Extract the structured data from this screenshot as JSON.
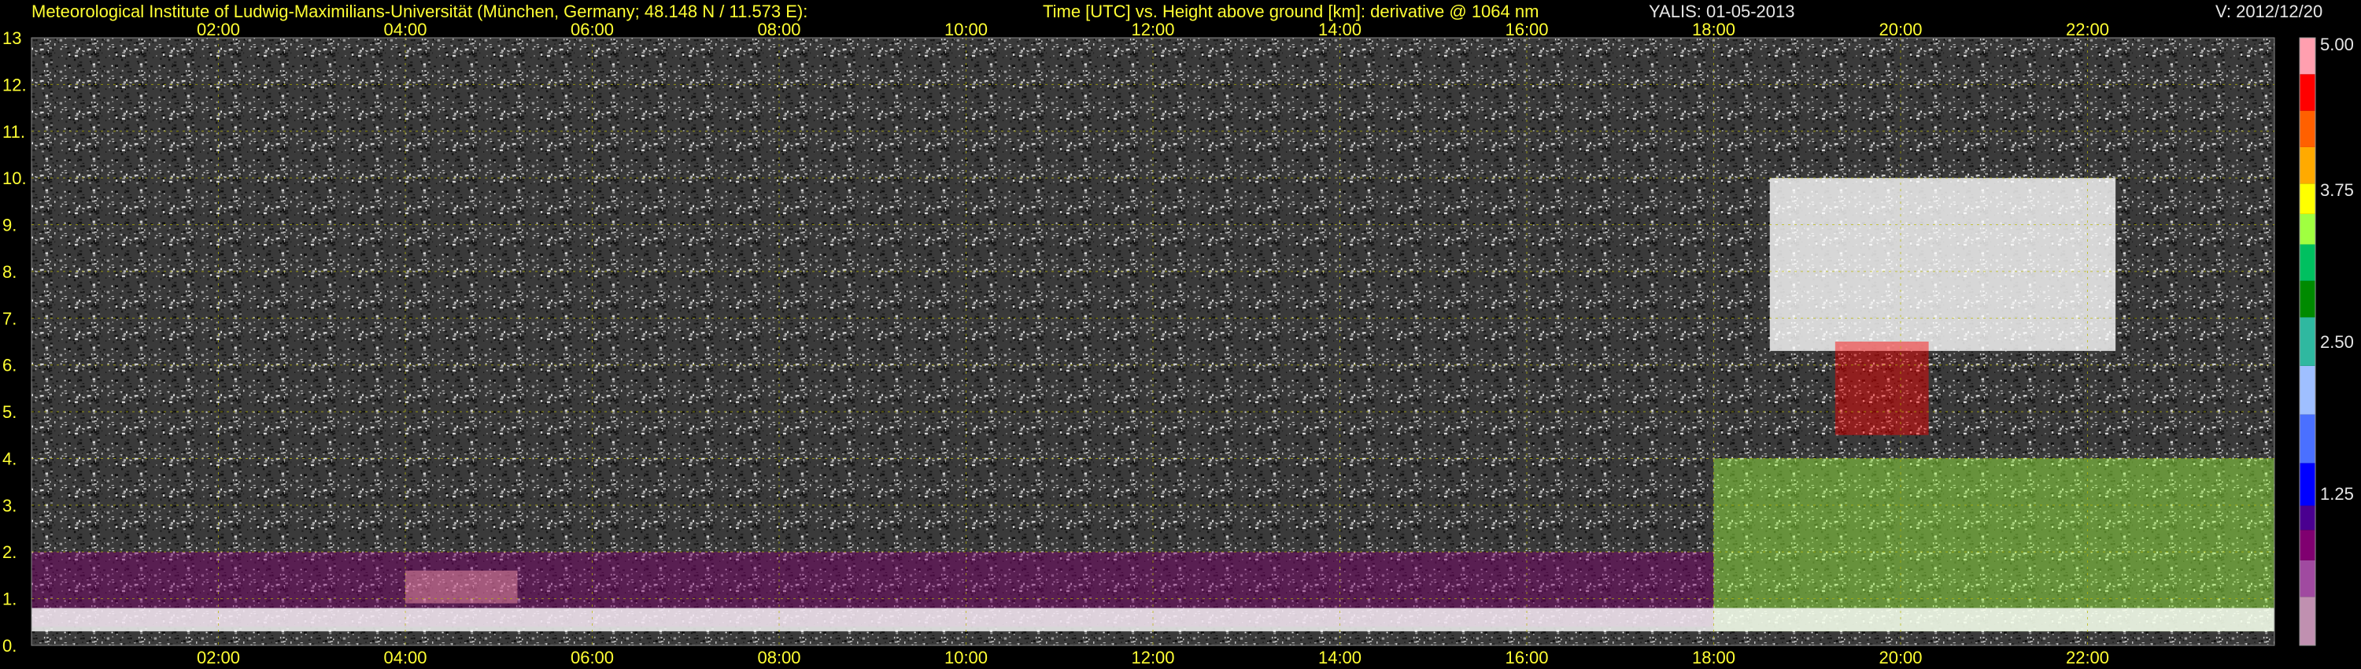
{
  "header": {
    "left": "Meteorological Institute of Ludwig-Maximilians-Universität (München, Germany; 48.148 N / 11.573 E):",
    "middle": "Time [UTC] vs. Height above ground [km]: derivative @ 1064 nm",
    "date": "YALIS: 01-05-2013",
    "version": "V: 2012/12/20"
  },
  "chart_data": {
    "type": "heatmap",
    "xlabel": "Time [UTC]",
    "ylabel": "Height above ground [km]",
    "x_unit": "hours UTC",
    "xlim": [
      0,
      24
    ],
    "ylim": [
      0,
      13
    ],
    "x_ticks": [
      {
        "value": 2,
        "label": "02:00"
      },
      {
        "value": 4,
        "label": "04:00"
      },
      {
        "value": 6,
        "label": "06:00"
      },
      {
        "value": 8,
        "label": "08:00"
      },
      {
        "value": 10,
        "label": "10:00"
      },
      {
        "value": 12,
        "label": "12:00"
      },
      {
        "value": 14,
        "label": "14:00"
      },
      {
        "value": 16,
        "label": "16:00"
      },
      {
        "value": 18,
        "label": "18:00"
      },
      {
        "value": 20,
        "label": "20:00"
      },
      {
        "value": 22,
        "label": "22:00"
      }
    ],
    "y_ticks": [
      0,
      1,
      2,
      3,
      4,
      5,
      6,
      7,
      8,
      9,
      10,
      11,
      12,
      13
    ],
    "y_tick_labels": [
      "0.",
      "1.",
      "2.",
      "3.",
      "4.",
      "5.",
      "6.",
      "7.",
      "8.",
      "9.",
      "10.",
      "11.",
      "12.",
      "13"
    ],
    "grid": true,
    "colorbar": {
      "range": [
        0,
        5.0
      ],
      "tick_values": [
        1.25,
        2.5,
        3.75,
        5.0
      ],
      "tick_labels": [
        "1.25",
        "2.50",
        "3.75",
        "5.00"
      ],
      "stops": [
        {
          "value": 0.0,
          "color": "#c090b0"
        },
        {
          "value": 0.4,
          "color": "#a04aa0"
        },
        {
          "value": 0.7,
          "color": "#800070"
        },
        {
          "value": 0.95,
          "color": "#4a0090"
        },
        {
          "value": 1.15,
          "color": "#0000ff"
        },
        {
          "value": 1.5,
          "color": "#4a70ff"
        },
        {
          "value": 1.9,
          "color": "#9fbfff"
        },
        {
          "value": 2.3,
          "color": "#2fb8a0"
        },
        {
          "value": 2.7,
          "color": "#008a00"
        },
        {
          "value": 3.0,
          "color": "#00c060"
        },
        {
          "value": 3.3,
          "color": "#a0ff40"
        },
        {
          "value": 3.55,
          "color": "#ffff00"
        },
        {
          "value": 3.8,
          "color": "#ffaa00"
        },
        {
          "value": 4.1,
          "color": "#ff6000"
        },
        {
          "value": 4.4,
          "color": "#ff0000"
        },
        {
          "value": 4.7,
          "color": "#ff9faf"
        },
        {
          "value": 5.0,
          "color": "#ffffff"
        }
      ]
    },
    "features": [
      {
        "name": "boundary-layer-aerosol",
        "t_start": 0,
        "t_end": 18,
        "z_bottom": 0.4,
        "z_top": 2.0,
        "value": 0.7
      },
      {
        "name": "bright-aerosol-patch",
        "t_start": 4.0,
        "t_end": 5.2,
        "z_bottom": 0.9,
        "z_top": 1.6,
        "value": 4.8
      },
      {
        "name": "cirrus-cloud",
        "t_start": 18.6,
        "t_end": 22.3,
        "z_bottom": 6.3,
        "z_top": 10.0,
        "value": 5.0
      },
      {
        "name": "mid-level-cloud-streaks",
        "t_start": 19.3,
        "t_end": 20.3,
        "z_bottom": 4.5,
        "z_top": 6.5,
        "value": 4.5
      },
      {
        "name": "evening-boundary-layer",
        "t_start": 18.0,
        "t_end": 24,
        "z_bottom": 0.3,
        "z_top": 4.0,
        "value": 3.5
      },
      {
        "name": "surface-return-layer",
        "t_start": 0,
        "t_end": 24,
        "z_bottom": 0.3,
        "z_top": 0.8,
        "value": 5.0
      }
    ]
  }
}
